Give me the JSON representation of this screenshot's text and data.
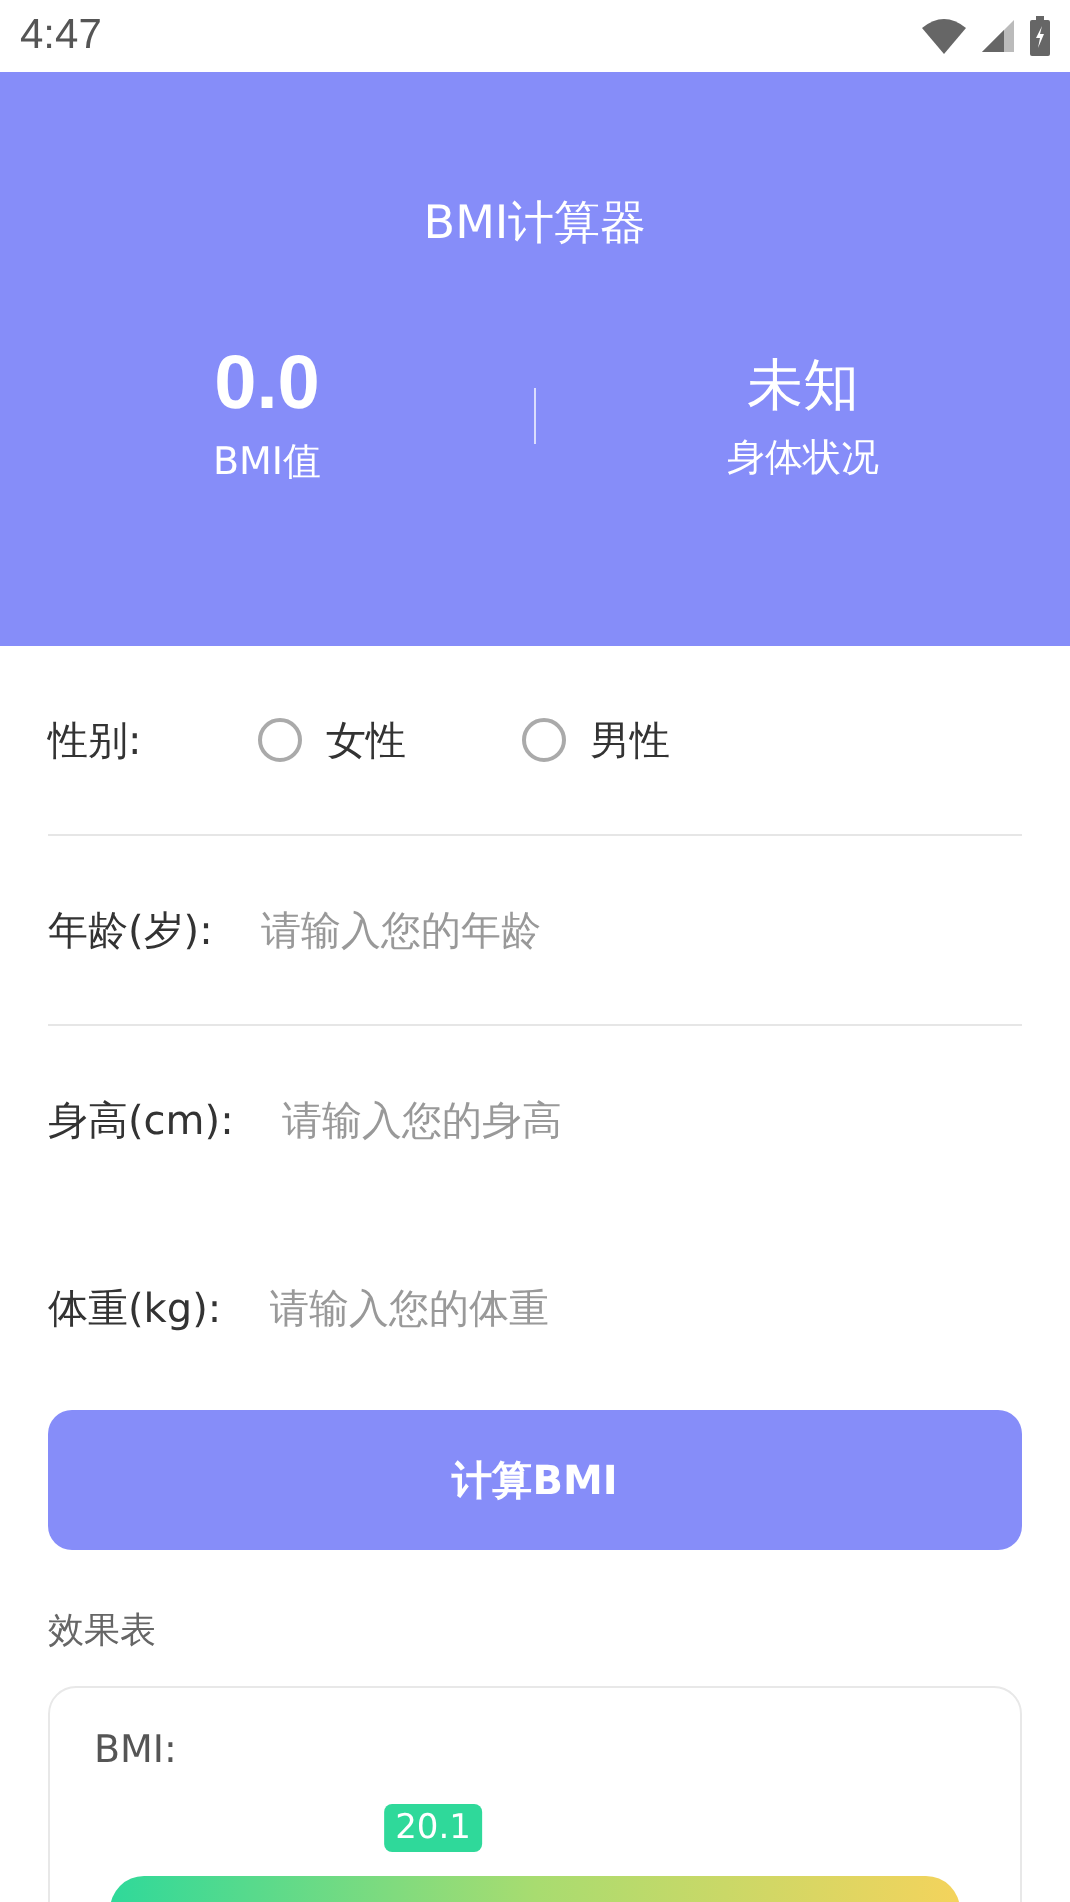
{
  "status_bar": {
    "time": "4:47"
  },
  "header": {
    "title": "BMI计算器",
    "stats": [
      {
        "value": "0.0",
        "label": "BMI值"
      },
      {
        "value": "未知",
        "label": "身体状况"
      }
    ]
  },
  "form": {
    "gender": {
      "label": "性别:",
      "options": [
        {
          "label": "女性",
          "selected": false
        },
        {
          "label": "男性",
          "selected": false
        }
      ]
    },
    "fields": [
      {
        "label": "年龄(岁):",
        "placeholder": "请输入您的年龄"
      },
      {
        "label": "身高(cm):",
        "placeholder": "请输入您的身高"
      },
      {
        "label": "体重(kg):",
        "placeholder": "请输入您的体重"
      }
    ],
    "button": "计算BMI"
  },
  "results": {
    "title": "效果表",
    "card_label": "BMI:",
    "marker": {
      "value": "20.1",
      "level": 0.38
    }
  }
}
